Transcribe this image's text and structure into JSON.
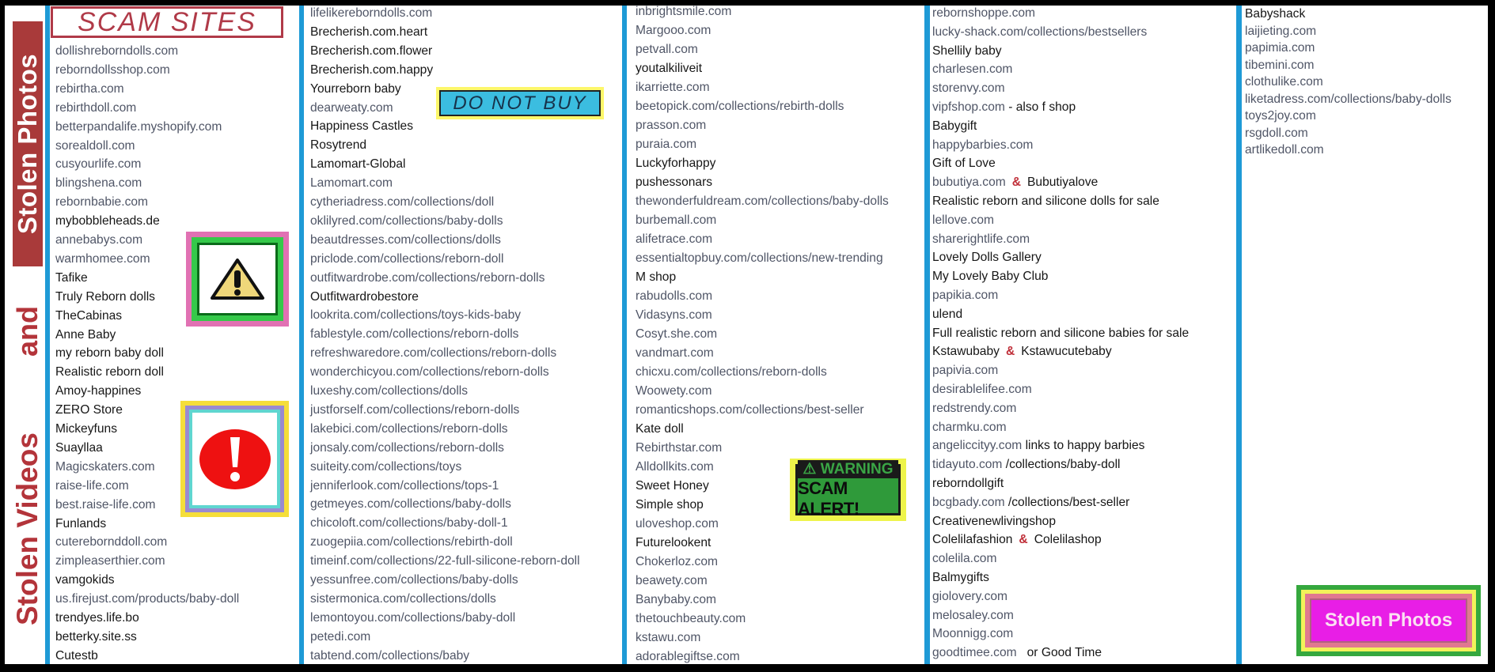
{
  "sidebar": {
    "stolen_photos": "Stolen Photos",
    "and": "and",
    "stolen_videos": "Stolen Videos"
  },
  "header": {
    "title": "SCAM SITES"
  },
  "badges": {
    "do_not_buy": "DO NOT BUY",
    "warning": "⚠ WARNING",
    "scam_alert": "SCAM ALERT!",
    "stolen_photos": "Stolen Photos"
  },
  "icons": {
    "warning": "warning-triangle-icon",
    "alert": "exclamation-circle-icon"
  },
  "colors": {
    "accent_blue": "#1e9ad6",
    "title_red": "#b03a48",
    "domain_text": "#4f5566",
    "name_text": "#161616",
    "ampersand": "#c0303a"
  },
  "columns": [
    {
      "items": [
        {
          "t": "dollishreborndolls.com",
          "k": "d"
        },
        {
          "t": "reborndollsshop.com",
          "k": "d"
        },
        {
          "t": "rebirtha.com",
          "k": "d"
        },
        {
          "t": "rebirthdoll.com",
          "k": "d"
        },
        {
          "t": "betterpandalife.myshopify.com",
          "k": "d"
        },
        {
          "t": "sorealdoll.com",
          "k": "d"
        },
        {
          "t": "cusyourlife.com",
          "k": "d"
        },
        {
          "t": "blingshena.com",
          "k": "d"
        },
        {
          "t": "rebornbabie.com",
          "k": "d"
        },
        {
          "t": "mybobbleheads.de",
          "k": "n"
        },
        {
          "t": "annebabys.com",
          "k": "d"
        },
        {
          "t": "warmhomee.com",
          "k": "d"
        },
        {
          "t": "Tafike",
          "k": "n"
        },
        {
          "t": "Truly Reborn dolls",
          "k": "n"
        },
        {
          "t": "TheCabinas",
          "k": "n"
        },
        {
          "t": "Anne Baby",
          "k": "n"
        },
        {
          "t": "my reborn baby doll",
          "k": "n"
        },
        {
          "t": "Realistic reborn doll",
          "k": "n"
        },
        {
          "t": "Amoy-happines",
          "k": "n"
        },
        {
          "t": "ZERO Store",
          "k": "n"
        },
        {
          "t": "Mickeyfuns",
          "k": "n"
        },
        {
          "t": "Suayllaa",
          "k": "n"
        },
        {
          "t": "Magicskaters.com",
          "k": "d"
        },
        {
          "t": "raise-life.com",
          "k": "d"
        },
        {
          "t": "best.raise-life.com",
          "k": "d"
        },
        {
          "t": "Funlands",
          "k": "n"
        },
        {
          "t": "cuterebornddoll.com",
          "k": "d"
        },
        {
          "t": "zimpleaserthier.com",
          "k": "d"
        },
        {
          "t": "vamgokids",
          "k": "n"
        },
        {
          "t": "us.firejust.com/products/baby-doll",
          "k": "d"
        },
        {
          "t": "trendyes.life.bo",
          "k": "n"
        },
        {
          "t": "betterky.site.ss",
          "k": "n"
        },
        {
          "t": "Cutestb",
          "k": "n"
        }
      ]
    },
    {
      "items": [
        {
          "t": "lifelikereborndolls.com",
          "k": "d"
        },
        {
          "t": "Brecherish.com.heart",
          "k": "n"
        },
        {
          "t": "Brecherish.com.flower",
          "k": "n"
        },
        {
          "t": "Brecherish.com.happy",
          "k": "n"
        },
        {
          "t": "Yourreborn baby",
          "k": "n"
        },
        {
          "t": "dearweaty.com",
          "k": "d"
        },
        {
          "t": "Happiness Castles",
          "k": "n"
        },
        {
          "t": "Rosytrend",
          "k": "n"
        },
        {
          "t": "Lamomart-Global",
          "k": "n"
        },
        {
          "t": "Lamomart.com",
          "k": "d"
        },
        {
          "t": "cytheriadress.com/collections/doll",
          "k": "d"
        },
        {
          "t": "oklilyred.com/collections/baby-dolls",
          "k": "d"
        },
        {
          "t": "beautdresses.com/collections/dolls",
          "k": "d"
        },
        {
          "t": "priclode.com/collections/reborn-doll",
          "k": "d"
        },
        {
          "t": "outfitwardrobe.com/collections/reborn-dolls",
          "k": "d"
        },
        {
          "t": "Outfitwardrobestore",
          "k": "n"
        },
        {
          "t": "lookrita.com/collections/toys-kids-baby",
          "k": "d"
        },
        {
          "t": "fablestyle.com/collections/reborn-dolls",
          "k": "d"
        },
        {
          "t": "refreshwaredore.com/collections/reborn-dolls",
          "k": "d"
        },
        {
          "t": "wonderchicyou.com/collections/reborn-dolls",
          "k": "d"
        },
        {
          "t": "luxeshy.com/collections/dolls",
          "k": "d"
        },
        {
          "t": "justforself.com/collections/reborn-dolls",
          "k": "d"
        },
        {
          "t": "lakebici.com/collections/reborn-dolls",
          "k": "d"
        },
        {
          "t": "jonsaly.com/collections/reborn-dolls",
          "k": "d"
        },
        {
          "t": "suiteity.com/collections/toys",
          "k": "d"
        },
        {
          "t": "jenniferlook.com/collections/tops-1",
          "k": "d"
        },
        {
          "t": "getmeyes.com/collections/baby-dolls",
          "k": "d"
        },
        {
          "t": "chicoloft.com/collections/baby-doll-1",
          "k": "d"
        },
        {
          "t": "zuogepiia.com/collections/rebirth-doll",
          "k": "d"
        },
        {
          "t": "timeinf.com/collections/22-full-silicone-reborn-doll",
          "k": "d"
        },
        {
          "t": "yessunfree.com/collections/baby-dolls",
          "k": "d"
        },
        {
          "t": "sistermonica.com/collections/dolls",
          "k": "d"
        },
        {
          "t": "lemontoyou.com/collections/baby-doll",
          "k": "d"
        },
        {
          "t": "petedi.com",
          "k": "d"
        },
        {
          "t": "tabtend.com/collections/baby",
          "k": "d"
        }
      ]
    },
    {
      "items": [
        {
          "t": "inbrightsmile.com",
          "k": "d"
        },
        {
          "t": "Margooo.com",
          "k": "d"
        },
        {
          "t": "petvall.com",
          "k": "d"
        },
        {
          "t": "youtalkiliveit",
          "k": "n"
        },
        {
          "t": "ikarriette.com",
          "k": "d"
        },
        {
          "t": "beetopick.com/collections/rebirth-dolls",
          "k": "d"
        },
        {
          "t": "prasson.com",
          "k": "d"
        },
        {
          "t": "puraia.com",
          "k": "d"
        },
        {
          "t": "Luckyforhappy",
          "k": "n"
        },
        {
          "t": "pushessonars",
          "k": "n"
        },
        {
          "t": "thewonderfuldream.com/collections/baby-dolls",
          "k": "d"
        },
        {
          "t": "burbemall.com",
          "k": "d"
        },
        {
          "t": "alifetrace.com",
          "k": "d"
        },
        {
          "t": "essentialtopbuy.com/collections/new-trending",
          "k": "d"
        },
        {
          "t": "M shop",
          "k": "n"
        },
        {
          "t": "rabudolls.com",
          "k": "d"
        },
        {
          "t": "Vidasyns.com",
          "k": "d"
        },
        {
          "t": "Cosyt.she.com",
          "k": "d"
        },
        {
          "t": "vandmart.com",
          "k": "d"
        },
        {
          "t": "chicxu.com/collections/reborn-dolls",
          "k": "d"
        },
        {
          "t": "Woowety.com",
          "k": "d"
        },
        {
          "t": "romanticshops.com/collections/best-seller",
          "k": "d"
        },
        {
          "t": "Kate doll",
          "k": "n"
        },
        {
          "t": "Rebirthstar.com",
          "k": "d"
        },
        {
          "t": "Alldollkits.com",
          "k": "d"
        },
        {
          "t": "Sweet Honey",
          "k": "n"
        },
        {
          "t": "Simple shop",
          "k": "n"
        },
        {
          "t": "uloveshop.com",
          "k": "d"
        },
        {
          "t": "Futurelookent",
          "k": "n"
        },
        {
          "t": "Chokerloz.com",
          "k": "d"
        },
        {
          "t": "beawety.com",
          "k": "d"
        },
        {
          "t": "Banybaby.com",
          "k": "d"
        },
        {
          "t": "thetouchbeauty.com",
          "k": "d"
        },
        {
          "t": "kstawu.com",
          "k": "d"
        },
        {
          "t": "adorablegiftse.com",
          "k": "d"
        }
      ]
    },
    {
      "items": [
        {
          "t": "rebornshoppe.com",
          "k": "d"
        },
        {
          "t": "lucky-shack.com/collections/bestsellers",
          "k": "d"
        },
        {
          "t": "Shellily baby",
          "k": "n"
        },
        {
          "t": "charlesen.com",
          "k": "d"
        },
        {
          "t": "storenvy.com",
          "k": "d"
        },
        {
          "parts": [
            {
              "t": "vipfshop.com",
              "k": "d"
            },
            {
              "t": " - also f shop",
              "k": "n"
            }
          ]
        },
        {
          "t": "Babygift",
          "k": "n"
        },
        {
          "t": "happybarbies.com",
          "k": "d"
        },
        {
          "t": "Gift of Love",
          "k": "n"
        },
        {
          "parts": [
            {
              "t": "bubutiya.com",
              "k": "d"
            },
            {
              "t": "&",
              "k": "amp"
            },
            {
              "t": "Bubutiyalove",
              "k": "n"
            }
          ]
        },
        {
          "t": "Realistic reborn and silicone dolls for sale",
          "k": "n"
        },
        {
          "t": "lellove.com",
          "k": "d"
        },
        {
          "t": "sharerightlife.com",
          "k": "d"
        },
        {
          "t": "Lovely Dolls Gallery",
          "k": "n"
        },
        {
          "t": "My Lovely Baby Club",
          "k": "n"
        },
        {
          "t": "papikia.com",
          "k": "d"
        },
        {
          "t": "ulend",
          "k": "n"
        },
        {
          "t": "Full realistic reborn and silicone babies for sale",
          "k": "n"
        },
        {
          "parts": [
            {
              "t": "Kstawubaby",
              "k": "n"
            },
            {
              "t": "&",
              "k": "amp"
            },
            {
              "t": "Kstawucutebaby",
              "k": "n"
            }
          ]
        },
        {
          "t": "papivia.com",
          "k": "d"
        },
        {
          "t": "desirablelifee.com",
          "k": "d"
        },
        {
          "t": "redstrendy.com",
          "k": "d"
        },
        {
          "t": "charmku.com",
          "k": "d"
        },
        {
          "parts": [
            {
              "t": "angeliccityy.com",
              "k": "d"
            },
            {
              "t": " links to happy barbies",
              "k": "n"
            }
          ]
        },
        {
          "parts": [
            {
              "t": "tidayuto.com",
              "k": "d"
            },
            {
              "t": " /collections/baby-doll",
              "k": "n"
            }
          ]
        },
        {
          "t": "reborndollgift",
          "k": "n"
        },
        {
          "parts": [
            {
              "t": "bcgbady.com",
              "k": "d"
            },
            {
              "t": " /collections/best-seller",
              "k": "n"
            }
          ]
        },
        {
          "t": "Creativenewlivingshop",
          "k": "n"
        },
        {
          "parts": [
            {
              "t": "Colelilafashion",
              "k": "n"
            },
            {
              "t": "&",
              "k": "amp"
            },
            {
              "t": "Colelilashop",
              "k": "n"
            }
          ]
        },
        {
          "t": "colelila.com",
          "k": "d"
        },
        {
          "t": "Balmygifts",
          "k": "n"
        },
        {
          "t": "giolovery.com",
          "k": "d"
        },
        {
          "t": "melosaley.com",
          "k": "d"
        },
        {
          "t": "Moonnigg.com",
          "k": "d"
        },
        {
          "parts": [
            {
              "t": "goodtimee.com",
              "k": "d"
            },
            {
              "t": "   or Good Time",
              "k": "n"
            }
          ]
        }
      ]
    },
    {
      "items": [
        {
          "t": "Babyshack",
          "k": "n"
        },
        {
          "t": "laijieting.com",
          "k": "d"
        },
        {
          "t": "papimia.com",
          "k": "d"
        },
        {
          "t": "tibemini.com",
          "k": "d"
        },
        {
          "t": "clothulike.com",
          "k": "d"
        },
        {
          "t": "liketadress.com/collections/baby-dolls",
          "k": "d"
        },
        {
          "t": "toys2joy.com",
          "k": "d"
        },
        {
          "t": "rsgdoll.com",
          "k": "d"
        },
        {
          "t": "artlikedoll.com",
          "k": "d"
        }
      ]
    }
  ]
}
